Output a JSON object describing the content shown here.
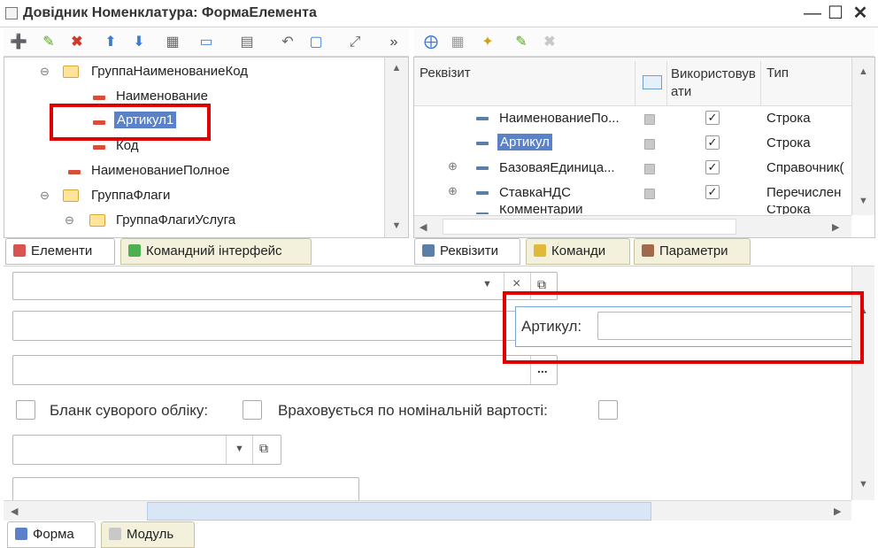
{
  "window": {
    "title": "Довідник Номенклатура: ФормаЕлемента"
  },
  "left_tree": {
    "items": [
      {
        "label": "ГруппаНаименованиеКод",
        "kind": "group"
      },
      {
        "label": "Наименование",
        "kind": "field"
      },
      {
        "label": "Артикул1",
        "kind": "field",
        "selected": true
      },
      {
        "label": "Код",
        "kind": "field"
      },
      {
        "label": "НаименованиеПолное",
        "kind": "field"
      },
      {
        "label": "ГруппаФлаги",
        "kind": "group"
      },
      {
        "label": "ГруппаФлагиУслуга",
        "kind": "group"
      }
    ]
  },
  "left_tabs": {
    "elements": "Елементи",
    "command_interface": "Командний інтерфейс"
  },
  "right_table": {
    "headers": {
      "requisite": "Реквізит",
      "use": "Використовувати",
      "type": "Тип"
    },
    "rows": [
      {
        "name": "НаименованиеПо...",
        "type": "Строка",
        "checked": true
      },
      {
        "name": "Артикул",
        "type": "Строка",
        "checked": true,
        "selected": true
      },
      {
        "name": "БазоваяЕдиница...",
        "type": "Справочник(",
        "checked": true
      },
      {
        "name": "СтавкаНДС",
        "type": "Перечислен",
        "checked": true
      },
      {
        "name": "Комментарий",
        "type": "Строка",
        "checked": true
      }
    ]
  },
  "right_tabs": {
    "requisites": "Реквізити",
    "commands": "Команди",
    "parameters": "Параметри"
  },
  "form_preview": {
    "article_label": "Артикул:",
    "blank_label": "Бланк суворого обліку:",
    "nominal_label": "Враховується по номінальній вартості:",
    "ellipsis": "...",
    "clear_symbol": "×"
  },
  "bottom_tabs": {
    "form": "Форма",
    "module": "Модуль"
  },
  "colors": {
    "highlight_red": "#e00000",
    "selection_blue": "#5b82c8"
  }
}
